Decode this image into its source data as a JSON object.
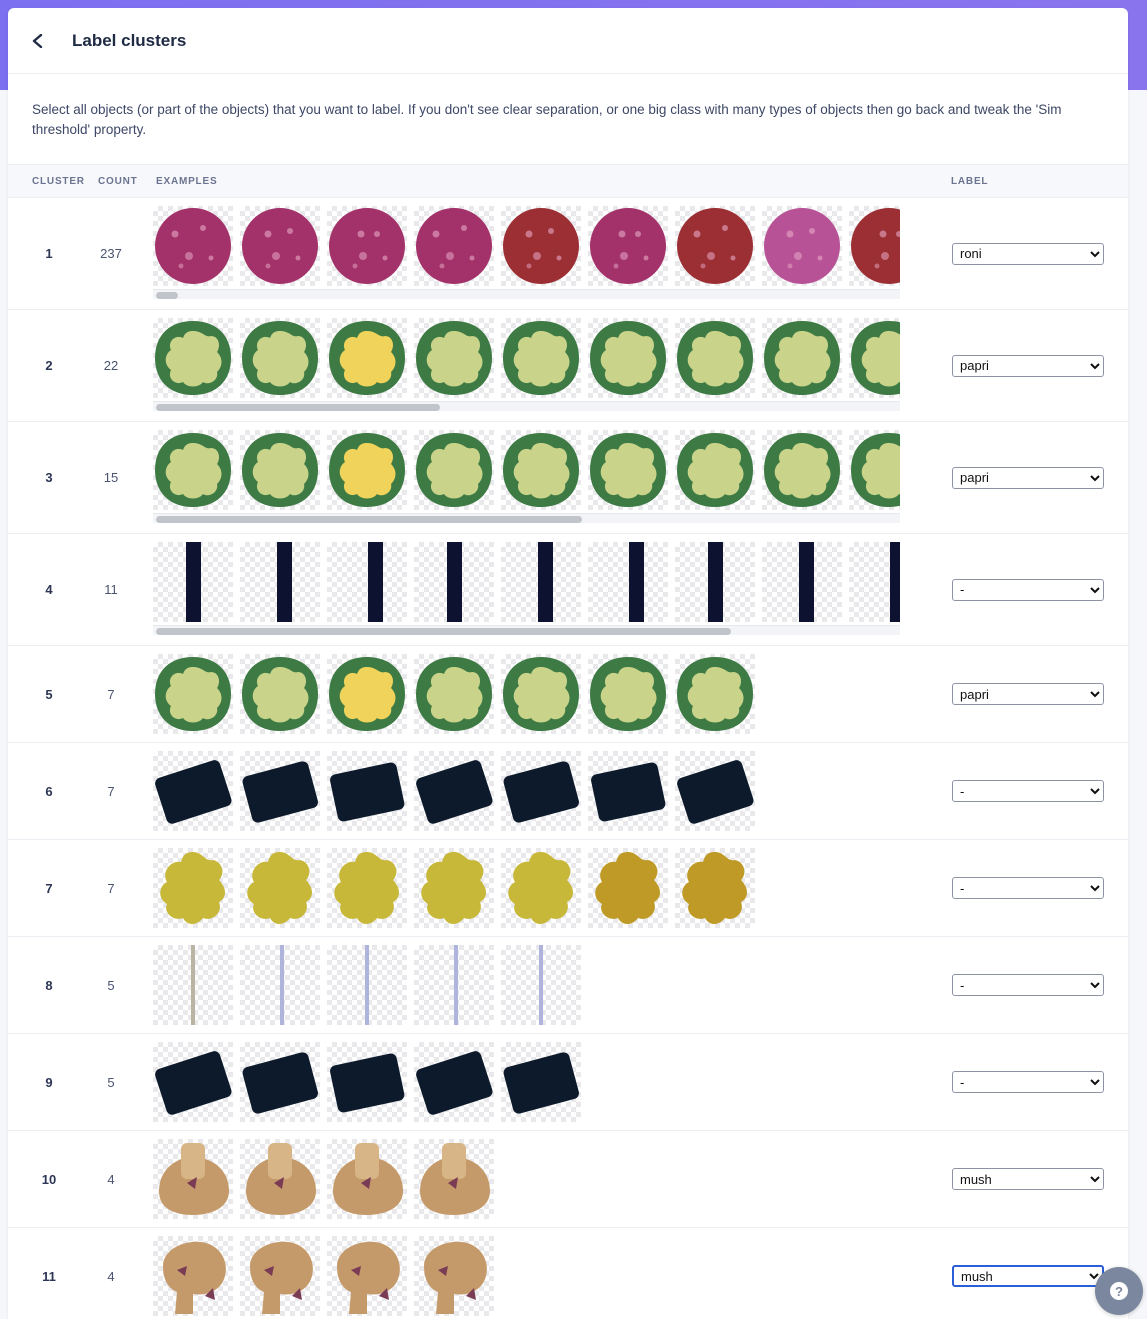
{
  "header": {
    "title": "Label clusters"
  },
  "intro": "Select all objects (or part of the objects) that you want to label. If you don't see clear separation, or one big class with many types of objects then go back and tweak the 'Sim threshold' property.",
  "columns": {
    "cluster": "CLUSTER",
    "count": "COUNT",
    "examples": "EXAMPLES",
    "label": "LABEL"
  },
  "clusters": [
    {
      "id": "1",
      "count": "237",
      "label": "roni",
      "examples": 9,
      "kind": "pepperoni",
      "scroll": 0.03,
      "rowH": 112
    },
    {
      "id": "2",
      "count": "22",
      "label": "papri",
      "examples": 9,
      "kind": "pepper",
      "scroll": 0.38,
      "rowH": 112
    },
    {
      "id": "3",
      "count": "15",
      "label": "papri",
      "examples": 9,
      "kind": "pepper",
      "scroll": 0.57,
      "rowH": 112
    },
    {
      "id": "4",
      "count": "11",
      "label": "-",
      "examples": 9,
      "kind": "stick",
      "scroll": 0.77,
      "rowH": 112
    },
    {
      "id": "5",
      "count": "7",
      "label": "papri",
      "examples": 7,
      "kind": "pepper",
      "rowH": 97
    },
    {
      "id": "6",
      "count": "7",
      "label": "-",
      "examples": 7,
      "kind": "olive",
      "rowH": 97
    },
    {
      "id": "7",
      "count": "7",
      "label": "-",
      "examples": 7,
      "kind": "pineapple",
      "rowH": 97
    },
    {
      "id": "8",
      "count": "5",
      "label": "-",
      "examples": 5,
      "kind": "line",
      "rowH": 97
    },
    {
      "id": "9",
      "count": "5",
      "label": "-",
      "examples": 5,
      "kind": "olive",
      "rowH": 97
    },
    {
      "id": "10",
      "count": "4",
      "label": "mush",
      "examples": 4,
      "kind": "mushroom",
      "rowH": 97
    },
    {
      "id": "11",
      "count": "4",
      "label": "mush",
      "examples": 4,
      "kind": "mushroom2",
      "rowH": 97,
      "focused": true
    }
  ],
  "label_options": [
    "-",
    "roni",
    "papri",
    "mush"
  ],
  "help_glyph": "?",
  "colors": {
    "accent": "#7c6ff0",
    "pepperoni": "#a3326a",
    "pepper_outer": "#3d7a44",
    "pepper_inner": "#c9d48a",
    "olive": "#0c1a2b",
    "pineapple": "#c7b83a",
    "mushroom": "#c59a6a"
  }
}
